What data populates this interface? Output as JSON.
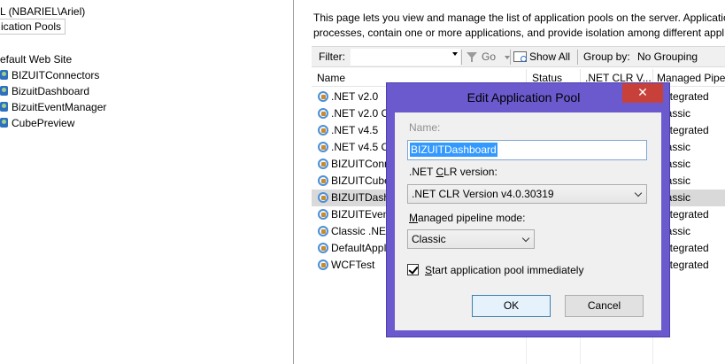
{
  "tree": {
    "server_node": "L (NBARIEL\\Ariel)",
    "app_pools_node": "ication Pools",
    "default_site": "efault Web Site",
    "apps": [
      "BIZUITConnectors",
      "BizuitDashboard",
      "BizuitEventManager",
      "CubePreview"
    ]
  },
  "description": {
    "line1": "This page lets you view and manage the list of application pools on the server. Applicatio",
    "line2": "processes, contain one or more applications, and provide isolation among different appl"
  },
  "filter_bar": {
    "filter_label": "Filter:",
    "filter_value": "",
    "go_label": "Go",
    "show_all_label": "Show All",
    "group_by_label": "Group by:",
    "grouping_value": "No Grouping"
  },
  "columns": [
    "Name",
    "Status",
    ".NET CLR V...",
    "Managed Pipe"
  ],
  "pools": [
    {
      "name": ".NET v2.0",
      "mode": "ntegrated"
    },
    {
      "name": ".NET v2.0 Cl",
      "mode": "lassic"
    },
    {
      "name": ".NET v4.5",
      "mode": "ntegrated"
    },
    {
      "name": ".NET v4.5 Cl",
      "mode": "lassic"
    },
    {
      "name": "BIZUITConn",
      "mode": "lassic"
    },
    {
      "name": "BIZUITCube",
      "mode": "lassic"
    },
    {
      "name": "BIZUITDashI",
      "mode": "lassic"
    },
    {
      "name": "BIZUITEvent",
      "mode": "ntegrated"
    },
    {
      "name": "Classic .NET",
      "mode": "lassic"
    },
    {
      "name": "DefaultAppI",
      "mode": "ntegrated"
    },
    {
      "name": "WCFTest",
      "mode": "ntegrated"
    }
  ],
  "selected_pool_index": 6,
  "dialog": {
    "title": "Edit Application Pool",
    "close_glyph": "✕",
    "name_label": "Name:",
    "name_value": "BIZUITDashboard",
    "clr_label_pre": ".NET ",
    "clr_label_accel": "C",
    "clr_label_post": "LR version:",
    "clr_value": ".NET CLR Version v4.0.30319",
    "mode_label_pre": "",
    "mode_label_accel": "M",
    "mode_label_post": "anaged pipeline mode:",
    "mode_value": "Classic",
    "start_label_pre": "",
    "start_label_accel": "S",
    "start_label_post": "tart application pool immediately",
    "start_checked": true,
    "ok_label": "OK",
    "cancel_label": "Cancel"
  },
  "colors": {
    "dialog_border": "#6a5acd",
    "close_button": "#c7403a",
    "selection": "#3399ff"
  }
}
